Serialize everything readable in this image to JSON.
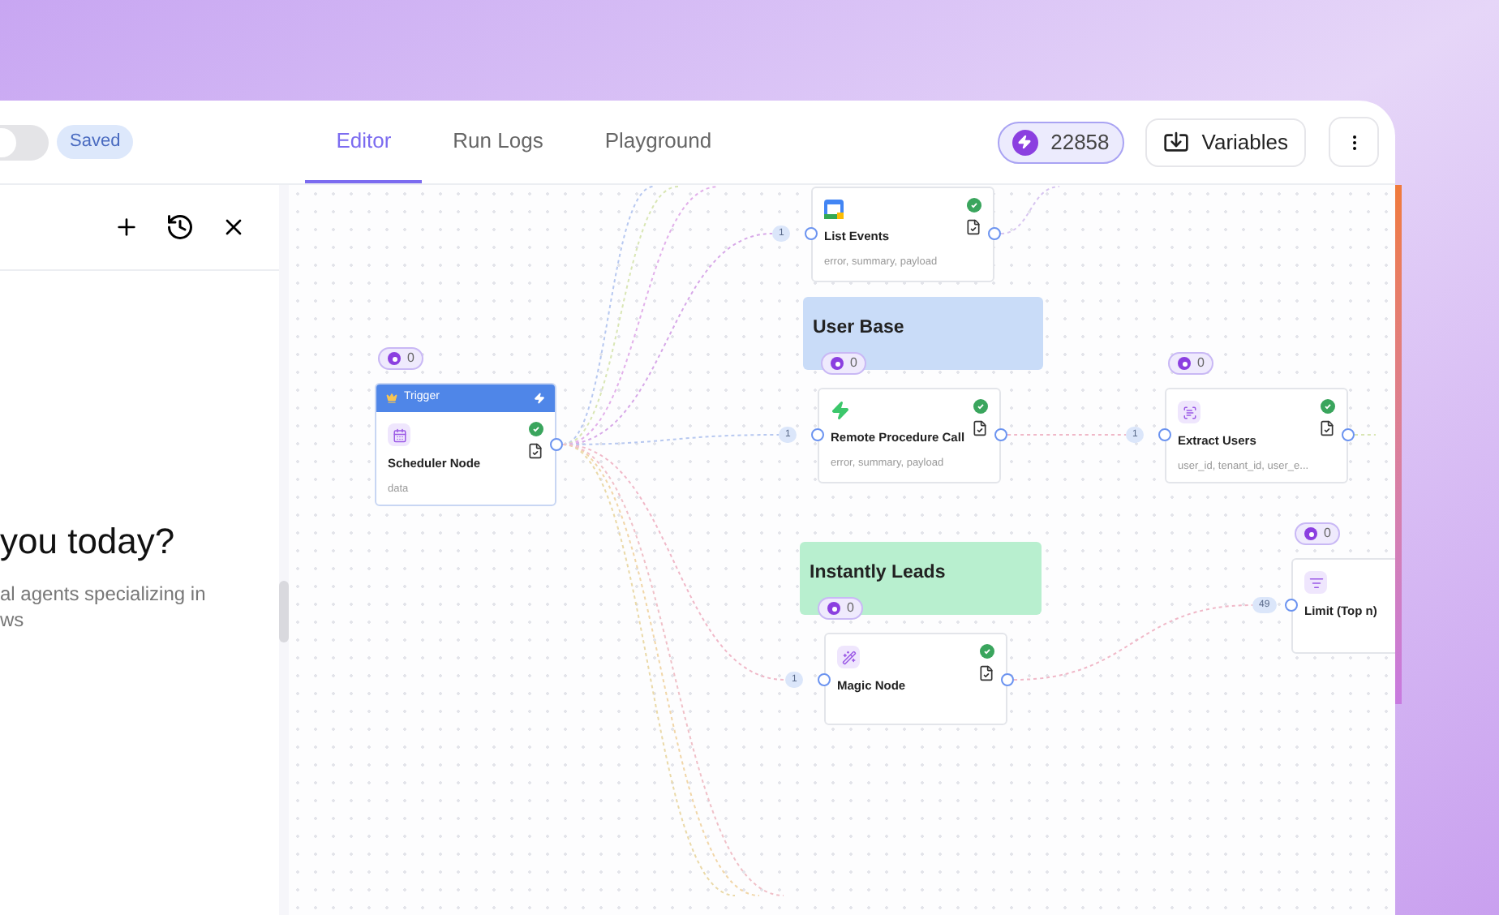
{
  "header": {
    "toggle": {
      "on": false
    },
    "save_status": "Saved",
    "tabs": [
      {
        "label": "Editor",
        "selected": true
      },
      {
        "label": "Run Logs",
        "selected": false
      },
      {
        "label": "Playground",
        "selected": false
      }
    ],
    "credits": "22858",
    "variables_button": "Variables"
  },
  "side_panel": {
    "heading": "you today?",
    "description": [
      "al agents specializing in",
      "ws"
    ]
  },
  "canvas": {
    "groups": [
      {
        "title": "User Base",
        "color": "#c9dcf8",
        "badge": "0"
      },
      {
        "title": "Instantly Leads",
        "color": "#b8efcf",
        "badge": "0"
      }
    ],
    "nodes": [
      {
        "kind": "calendar",
        "title": "List Events",
        "subtitle": "error, summary, payload",
        "succeeded": true,
        "input_count": "1"
      },
      {
        "kind": "trigger",
        "header": "Trigger",
        "title": "Scheduler Node",
        "subtitle": "data",
        "succeeded": true,
        "badge": "0"
      },
      {
        "kind": "rpc",
        "title": "Remote Procedure Call",
        "subtitle": "error, summary, payload",
        "succeeded": true,
        "input_count": "1"
      },
      {
        "kind": "extract",
        "title": "Extract Users",
        "subtitle": "user_id, tenant_id, user_e...",
        "succeeded": true,
        "input_count": "1",
        "badge": "0"
      },
      {
        "kind": "magic",
        "title": "Magic Node",
        "succeeded": true,
        "input_count": "1"
      },
      {
        "kind": "limit",
        "title": "Limit (Top n)",
        "input_count": "49",
        "badge": "0"
      }
    ]
  }
}
